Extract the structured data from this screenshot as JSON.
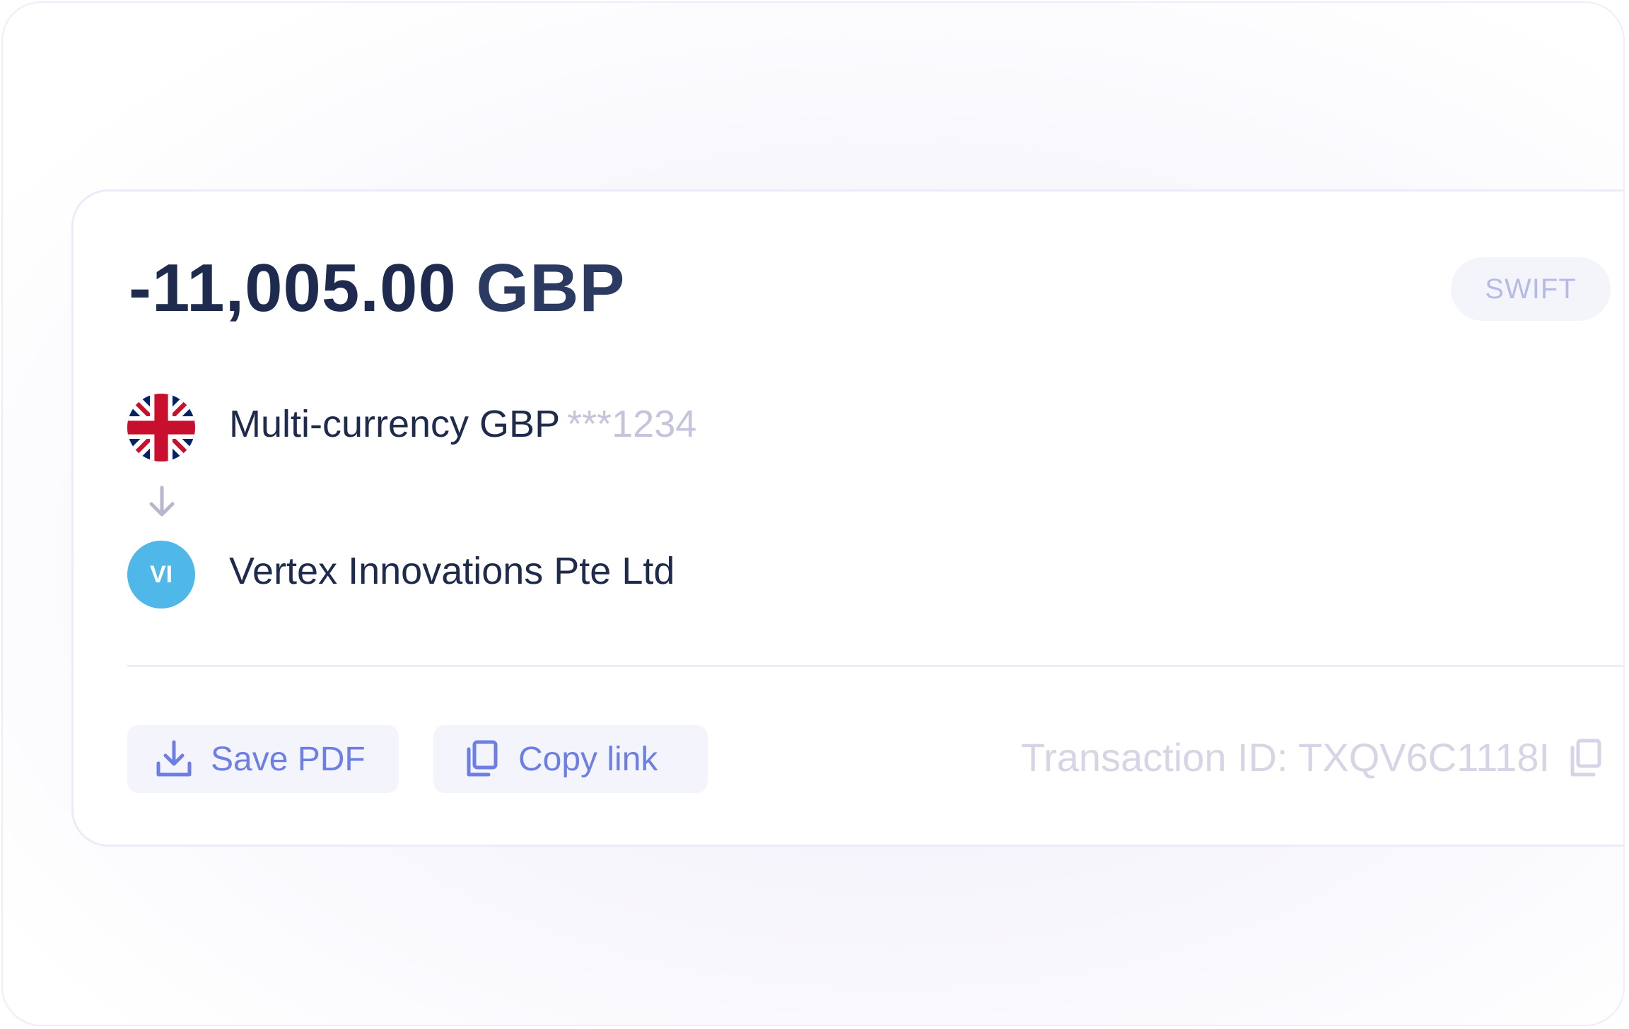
{
  "transaction": {
    "amount": "-11,005.00",
    "currency": "GBP",
    "method_badge": "SWIFT"
  },
  "from_account": {
    "flag_icon": "uk-flag-icon",
    "name": "Multi-currency GBP",
    "masked_number": "***1234"
  },
  "direction_icon": "arrow-down-icon",
  "recipient": {
    "initials": "VI",
    "name": "Vertex Innovations Pte Ltd",
    "avatar_color": "#4fb8e8"
  },
  "actions": {
    "save_pdf": {
      "label": "Save PDF",
      "icon": "download-icon"
    },
    "copy_link": {
      "label": "Copy link",
      "icon": "copy-icon"
    }
  },
  "transaction_id": {
    "text": "Transaction ID: TXQV6C1118I",
    "copy_icon": "copy-icon"
  },
  "colors": {
    "primary_text": "#1e2a4e",
    "accent": "#6e7fe4",
    "muted": "#c4c4dc",
    "badge_text": "#b6bbe6",
    "button_bg": "#f3f4fc"
  }
}
